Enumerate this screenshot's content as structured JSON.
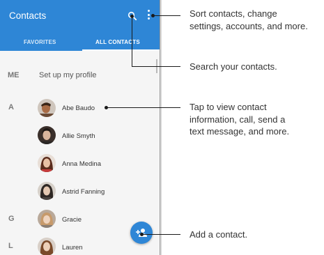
{
  "app": {
    "title": "Contacts",
    "tabs": [
      {
        "label": "FAVORITES",
        "selected": false
      },
      {
        "label": "ALL CONTACTS",
        "selected": true
      }
    ],
    "accent_color": "#2e86d6"
  },
  "profile": {
    "section_label": "ME",
    "text": "Set up my profile"
  },
  "sections": [
    {
      "letter": "A"
    },
    {
      "letter": "G"
    },
    {
      "letter": "L"
    }
  ],
  "contacts": [
    {
      "name": "Abe Baudo"
    },
    {
      "name": "Allie Smyth"
    },
    {
      "name": "Anna Medina"
    },
    {
      "name": "Astrid Fanning"
    },
    {
      "name": "Gracie"
    },
    {
      "name": "Lauren"
    }
  ],
  "icons": {
    "search": "search-icon",
    "more": "more-vert-icon",
    "add_contact": "add-contact-icon"
  },
  "callouts": {
    "menu": [
      "Sort contacts, change",
      "settings, accounts, and more."
    ],
    "search": [
      "Search your contacts."
    ],
    "contact": [
      "Tap to view contact",
      "information, call, send a",
      "text message, and more."
    ],
    "add": [
      "Add a contact."
    ]
  }
}
